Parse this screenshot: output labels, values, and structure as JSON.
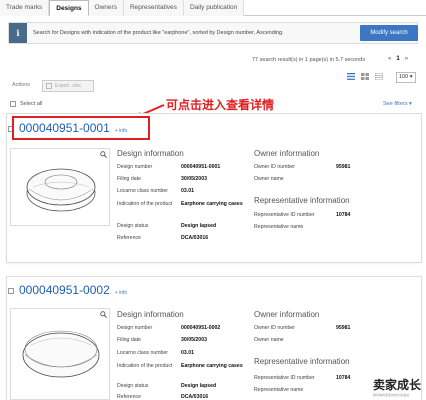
{
  "tabs": [
    "Trade marks",
    "Designs",
    "Owners",
    "Representatives",
    "Daily publication"
  ],
  "active_tab": "Designs",
  "info_text": "Search for Designs with indication of the product like \"earphone\", sorted by Design number, Ascending.",
  "modify_search": "Modify search",
  "results_count": "77 search result(s) in 1 page(s) in 5.7 seconds",
  "pager": {
    "prev": "«",
    "current": "1",
    "next": "»"
  },
  "per_page": "100",
  "actions_label": "Actions",
  "export_label": "Export .xlsx",
  "select_all": "Select all",
  "see_filters": "See filters",
  "annotation": "可点击进入查看详情",
  "info_link": "+ info",
  "design_info_title": "Design information",
  "owner_info_title": "Owner information",
  "rep_info_title": "Representative information",
  "labels": {
    "design_number": "Design number",
    "filing_date": "Filing date",
    "locarno": "Locarno class number",
    "indication": "Indication of the product",
    "status": "Design status",
    "reference": "Reference",
    "owner_id": "Owner ID number",
    "owner_name": "Owner name",
    "rep_id": "Representative ID number",
    "rep_name": "Representative name"
  },
  "records": [
    {
      "number": "000040951-0001",
      "design_number": "000040951-0001",
      "filing_date": "30/05/2003",
      "locarno": "03.01",
      "indication": "Earphone carrying cases",
      "status": "Design lapsed",
      "reference": "DCA/03016",
      "owner_id": "95981",
      "rep_id": "10784"
    },
    {
      "number": "000040951-0002",
      "design_number": "000040951-0002",
      "filing_date": "30/05/2003",
      "locarno": "03.01",
      "indication": "Earphone carrying cases",
      "status": "Design lapsed",
      "reference": "DCA/03016",
      "owner_id": "95981",
      "rep_id": "10784"
    }
  ],
  "watermark": "卖家成长",
  "watermark_sub": "跨境电商卖家的成长加油站",
  "colors": {
    "accent": "#3d76c2",
    "annotation": "#e02020",
    "title": "#1f5fb0"
  }
}
